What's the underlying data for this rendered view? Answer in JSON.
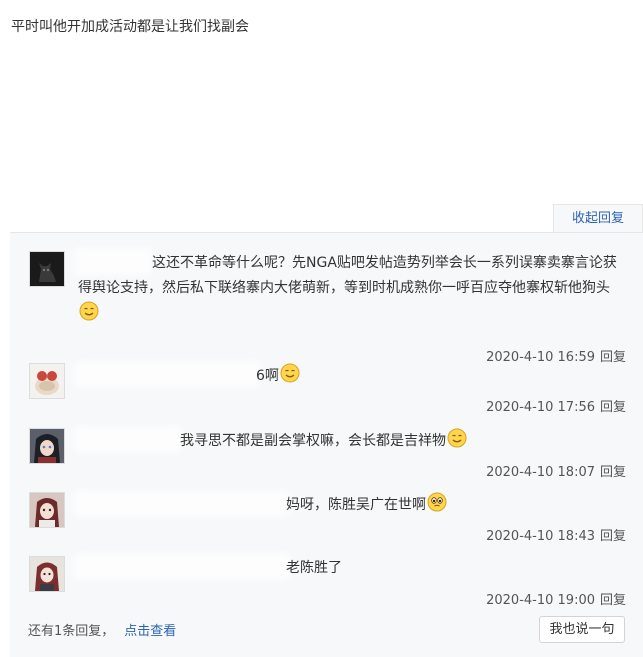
{
  "post": {
    "text": "平时叫他开加成活动都是让我们找副会"
  },
  "collapse_label": "收起回复",
  "replies": [
    {
      "text": "这还不革命等什么呢？先NGA贴吧发帖造势列举会长一系列误寨卖寨言论获得舆论支持，然后私下联络寨内大佬萌新，等到时机成熟你一呼百应夺他寨权斩他狗头",
      "time": "2020-4-10 16:59",
      "reply_label": "回复",
      "emoji": "smile-emoji"
    },
    {
      "text": "6啊",
      "time": "2020-4-10 17:56",
      "reply_label": "回复",
      "emoji": "smile-emoji"
    },
    {
      "text": "我寻思不都是副会掌权嘛，会长都是吉祥物",
      "time": "2020-4-10 18:07",
      "reply_label": "回复",
      "emoji": "smile-emoji"
    },
    {
      "text": "妈呀，陈胜吴广在世啊",
      "time": "2020-4-10 18:43",
      "reply_label": "回复",
      "emoji": "shocked-emoji"
    },
    {
      "text": "老陈胜了",
      "time": "2020-4-10 19:00",
      "reply_label": "回复"
    }
  ],
  "more": {
    "count_text": "还有1条回复，",
    "view_label": "点击查看"
  },
  "say_button": "我也说一句",
  "colors": {
    "link": "#2d64b3",
    "panel_bg": "#f7f8fa",
    "text": "#333333",
    "meta": "#555555"
  }
}
